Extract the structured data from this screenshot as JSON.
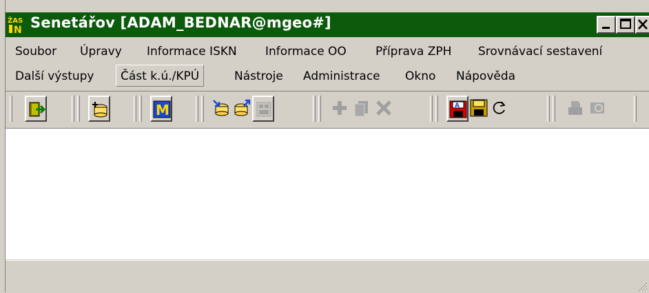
{
  "window": {
    "title": "Senetářov  [ADAM_BEDNAR@mgeo#]",
    "title_bar_color": "#0c5a0c"
  },
  "menu_row1": [
    {
      "label": "Soubor"
    },
    {
      "label": "Úpravy"
    },
    {
      "label": "Informace ISKN"
    },
    {
      "label": "Informace OO"
    },
    {
      "label": "Příprava ZPH"
    },
    {
      "label": "Srovnávací sestavení"
    }
  ],
  "menu_row2": [
    {
      "label": "Další výstupy"
    },
    {
      "label": "Část k.ú./KPÚ",
      "active": true
    },
    {
      "label": "Nástroje"
    },
    {
      "label": "Administrace"
    },
    {
      "label": "Okno"
    },
    {
      "label": "Nápověda"
    }
  ],
  "toolbar": {
    "buttons": [
      {
        "icon": "exit-icon",
        "enabled": true
      },
      {
        "icon": "database-add-icon",
        "enabled": true
      },
      {
        "icon": "m-app-icon",
        "enabled": true
      },
      {
        "icon": "db-import-icon",
        "enabled": true
      },
      {
        "icon": "db-export-icon",
        "enabled": true
      },
      {
        "icon": "db-calc-icon",
        "enabled": false
      },
      {
        "icon": "plus-icon",
        "enabled": false
      },
      {
        "icon": "copy-icon",
        "enabled": false
      },
      {
        "icon": "delete-icon",
        "enabled": false
      },
      {
        "icon": "save-as-icon",
        "enabled": true
      },
      {
        "icon": "save-icon",
        "enabled": true
      },
      {
        "icon": "refresh-icon",
        "enabled": true
      },
      {
        "icon": "print-icon",
        "enabled": false
      },
      {
        "icon": "print-preview-icon",
        "enabled": false
      }
    ]
  }
}
